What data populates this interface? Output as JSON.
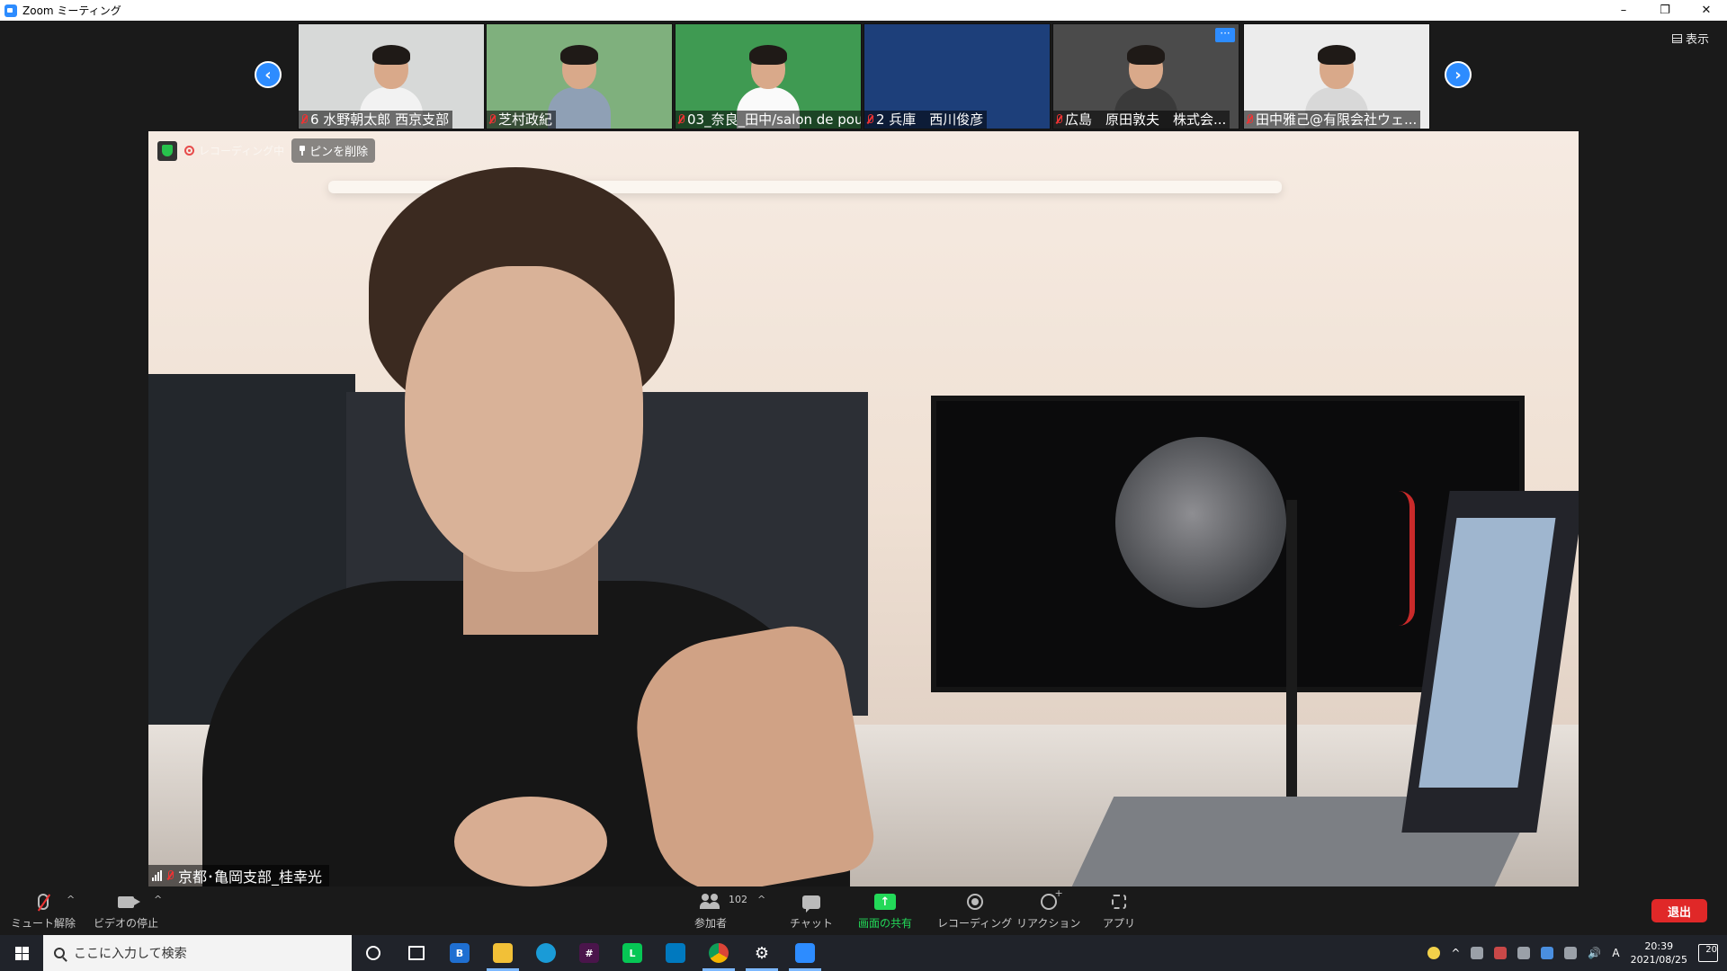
{
  "window": {
    "title": "Zoom ミーティング"
  },
  "top_strip": {
    "view_label": "表示",
    "participants": [
      {
        "name": "6 水野朝太郎 西京支部",
        "bg": "#d7d9d8",
        "shirt": "#f2f2f2"
      },
      {
        "name": "芝村政紀",
        "bg": "#7fb07d",
        "shirt": "#8fa0b5"
      },
      {
        "name": "03_奈良_田中/salon de pou...",
        "bg": "#3f9a52",
        "shirt": "#fafafa"
      },
      {
        "name": "2 兵庫　西川俊彦",
        "bg": "#1d3f7a",
        "shirt": ""
      },
      {
        "name": "広島　原田敦夫　株式会...",
        "bg": "#4b4b4b",
        "shirt": "#3a3a3a"
      },
      {
        "name": "田中雅己@有限会社ウェ...",
        "bg": "#ececec",
        "shirt": "#d8d8d8"
      }
    ]
  },
  "main_video": {
    "recording_label": "レコーディング中",
    "unpin_label": "ピンを削除",
    "speaker_name": "京都･亀岡支部_桂幸光"
  },
  "toolbar": {
    "unmute": "ミュート解除",
    "stop_video": "ビデオの停止",
    "participants": "参加者",
    "participant_count": "102",
    "chat": "チャット",
    "share": "画面の共有",
    "record": "レコーディング",
    "reactions": "リアクション",
    "apps": "アプリ",
    "leave": "退出"
  },
  "taskbar": {
    "search_placeholder": "ここに入力して検索",
    "time": "20:39",
    "date": "2021/08/25",
    "ime": "A",
    "notification_count": "20"
  }
}
